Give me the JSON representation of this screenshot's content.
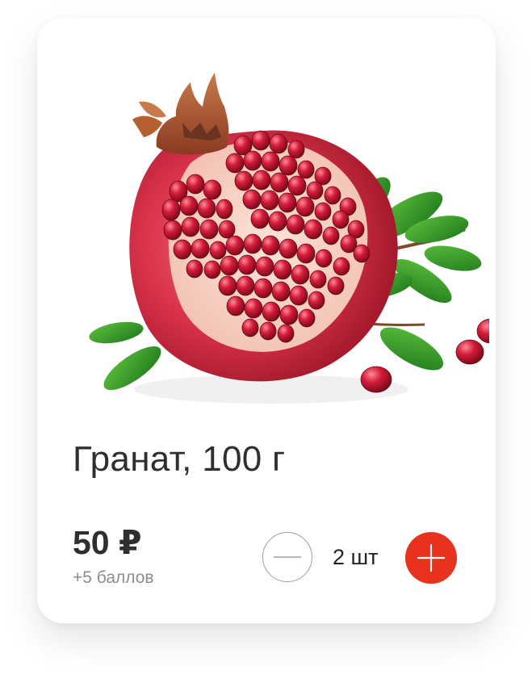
{
  "product": {
    "image": "pomegranate-photo",
    "title": "Гранат, 100 г",
    "price": "50 ₽",
    "bonus": "+5 баллов"
  },
  "cart_controls": {
    "minus_icon": "minus-icon",
    "plus_icon": "plus-icon",
    "quantity_label": "2 шт"
  },
  "colors": {
    "accent": "#e8321e",
    "title_text": "#2f2f2f",
    "muted_text": "#8c8c8c",
    "minus_border": "#9d9d9d"
  }
}
